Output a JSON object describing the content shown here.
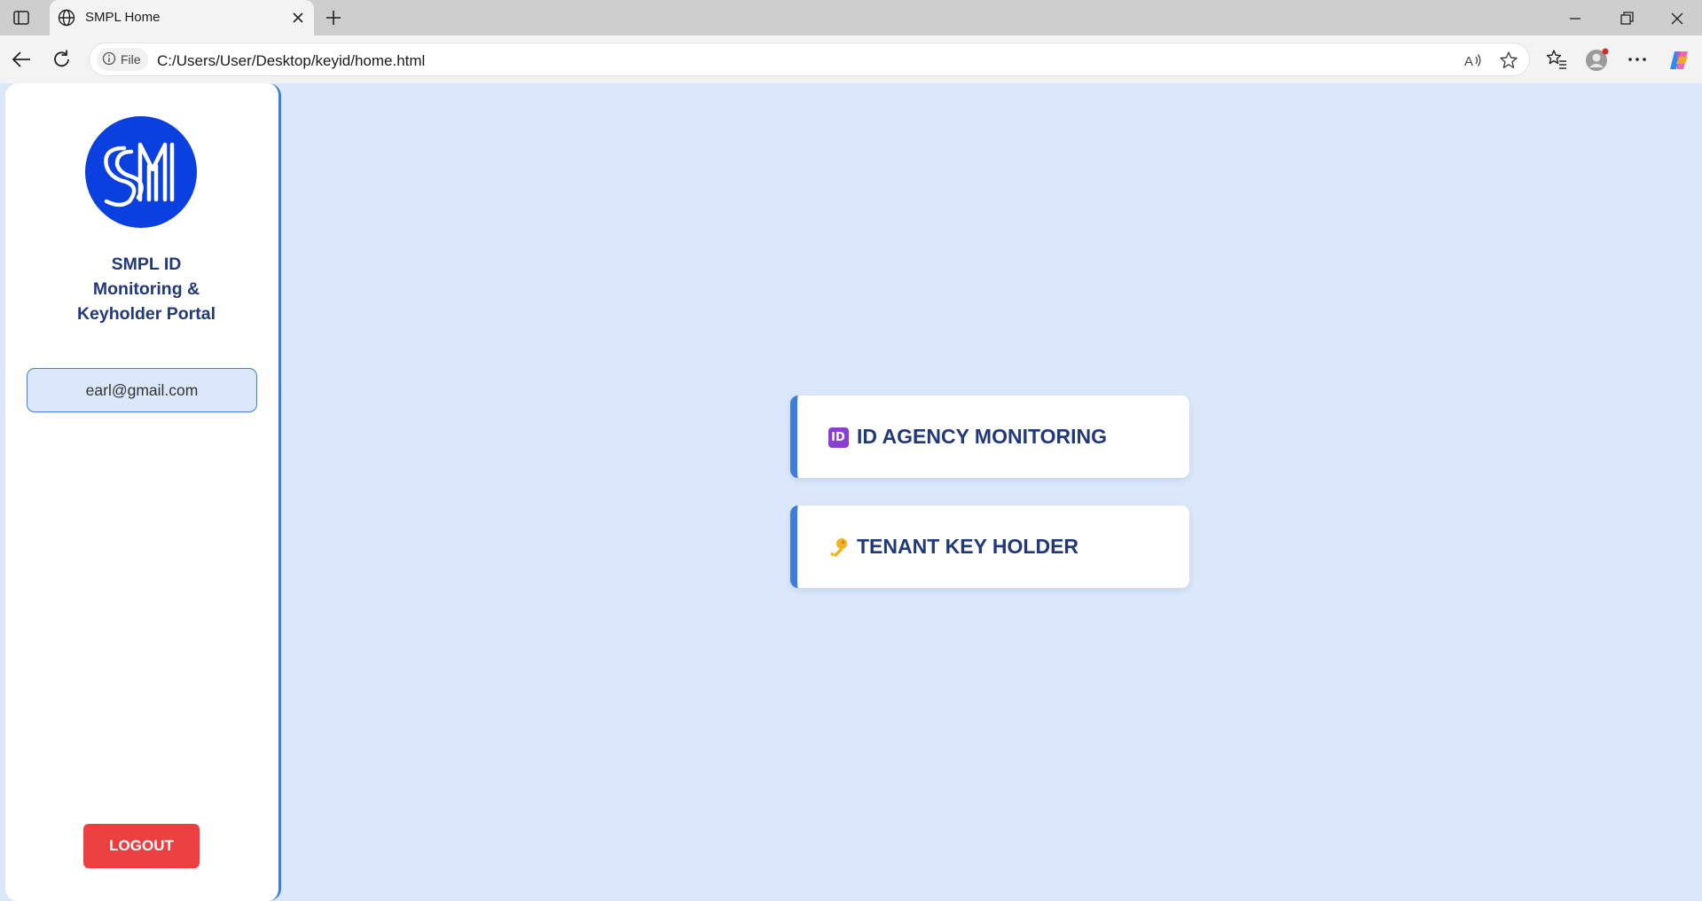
{
  "browser": {
    "tab_title": "SMPL Home",
    "file_chip": "File",
    "url": "C:/Users/User/Desktop/keyid/home.html"
  },
  "sidebar": {
    "portal_title": "SMPL ID\nMonitoring &\nKeyholder Portal",
    "user_email": "earl@gmail.com",
    "logout_label": "LOGOUT"
  },
  "menu": [
    {
      "label": "ID AGENCY MONITORING",
      "icon": "id-badge-icon",
      "badge_text": "ID"
    },
    {
      "label": "TENANT KEY HOLDER",
      "icon": "key-icon"
    }
  ],
  "colors": {
    "accent": "#3f7ddd",
    "title_text": "#21397a",
    "page_bg": "#dbe8fb",
    "logout": "#ec4040",
    "logo": "#0a3fe0"
  }
}
